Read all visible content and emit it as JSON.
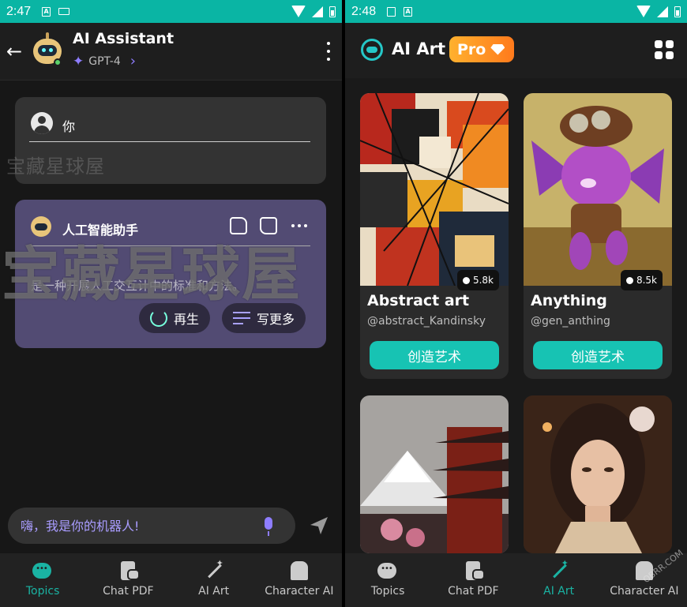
{
  "left": {
    "status": {
      "time": "2:47"
    },
    "header": {
      "title": "AI Assistant",
      "model": "GPT-4"
    },
    "user_message": {
      "name": "你"
    },
    "bot_message": {
      "name": "人工智能助手",
      "text": "是一种开展人工交互计中的标准和方法。",
      "regenerate_label": "再生",
      "write_more_label": "写更多"
    },
    "watermark_small": "宝藏星球屋",
    "watermark_big": "宝藏星球屋",
    "input": {
      "placeholder": "嗨，我是你的机器人!"
    },
    "nav": [
      {
        "label": "Topics",
        "icon": "chat-bubble-icon",
        "active": true
      },
      {
        "label": "Chat PDF",
        "icon": "pdf-chat-icon",
        "active": false
      },
      {
        "label": "AI Art",
        "icon": "magic-wand-icon",
        "active": false
      },
      {
        "label": "Character AI",
        "icon": "character-icon",
        "active": false
      }
    ]
  },
  "right": {
    "status": {
      "time": "2:48"
    },
    "header": {
      "title": "AI Art",
      "badge": "Pro"
    },
    "cards": [
      {
        "title": "Abstract art",
        "handle": "@abstract_Kandinsky",
        "users": "5.8k",
        "button": "创造艺术"
      },
      {
        "title": "Anything",
        "handle": "@gen_anthing",
        "users": "8.5k",
        "button": "创造艺术"
      },
      {
        "title": "",
        "handle": "",
        "users": "",
        "button": ""
      },
      {
        "title": "",
        "handle": "",
        "users": "",
        "button": ""
      }
    ],
    "nav": [
      {
        "label": "Topics",
        "icon": "chat-bubble-icon",
        "active": false
      },
      {
        "label": "Chat PDF",
        "icon": "pdf-chat-icon",
        "active": false
      },
      {
        "label": "AI Art",
        "icon": "magic-wand-icon",
        "active": true
      },
      {
        "label": "Character AI",
        "icon": "character-icon",
        "active": false
      }
    ]
  },
  "corner_watermark": "OBRR.COM",
  "colors": {
    "accent": "#1ab3a3",
    "statusbar": "#0ab5a4",
    "bot_card": "#524b73",
    "pro_badge": "#ff9a24",
    "purple": "#8e7dff"
  }
}
